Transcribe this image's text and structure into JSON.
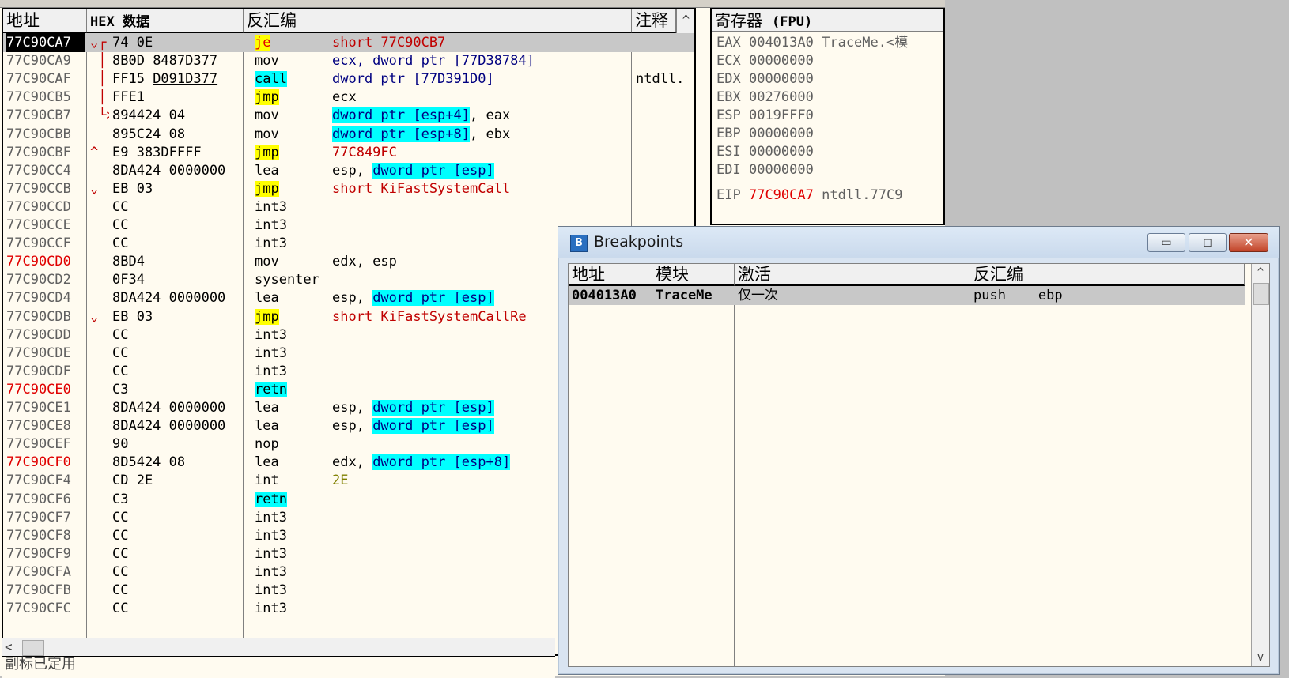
{
  "disasm": {
    "headers": [
      "地址",
      "HEX 数据",
      "反汇编",
      "注释"
    ],
    "rows": [
      {
        "addr": "77C90CA7",
        "mark": "⌄┌",
        "hex": "74 0E",
        "mn": "je",
        "mnstyle": "y",
        "op": "short 77C90CB7",
        "opstyle": "red",
        "cm": "",
        "sel": true,
        "addrred": false
      },
      {
        "addr": "77C90CA9",
        "mark": " │",
        "hex": "8B0D 8487D377",
        "mn": "mov",
        "mnstyle": "",
        "op": "ecx, dword ptr [77D38784]",
        "opstyle": "blue",
        "cm": "",
        "sel": false,
        "addrred": false
      },
      {
        "addr": "77C90CAF",
        "mark": " │",
        "hex": "FF15 D091D377",
        "mn": "call",
        "mnstyle": "c",
        "op": "dword ptr [77D391D0]",
        "opstyle": "blue",
        "cm": "ntdll.",
        "sel": false,
        "addrred": false
      },
      {
        "addr": "77C90CB5",
        "mark": " │",
        "hex": "FFE1",
        "mn": "jmp",
        "mnstyle": "y",
        "op": "ecx",
        "opstyle": "",
        "cm": "",
        "sel": false,
        "addrred": false
      },
      {
        "addr": "77C90CB7",
        "mark": " └>",
        "hex": "894424 04",
        "mn": "mov",
        "mnstyle": "",
        "op": "dword ptr [esp+4], eax",
        "opstyle": "hlfirst",
        "cm": "",
        "sel": false,
        "addrred": false
      },
      {
        "addr": "77C90CBB",
        "mark": "",
        "hex": "895C24 08",
        "mn": "mov",
        "mnstyle": "",
        "op": "dword ptr [esp+8], ebx",
        "opstyle": "hlfirst",
        "cm": "",
        "sel": false,
        "addrred": false
      },
      {
        "addr": "77C90CBF",
        "mark": "^",
        "hex": "E9 383DFFFF",
        "mn": "jmp",
        "mnstyle": "y",
        "op": "77C849FC",
        "opstyle": "red",
        "cm": "",
        "sel": false,
        "addrred": false
      },
      {
        "addr": "77C90CC4",
        "mark": "",
        "hex": "8DA424 0000000",
        "mn": "lea",
        "mnstyle": "",
        "op": "esp, dword ptr [esp]",
        "opstyle": "hllast",
        "cm": "",
        "sel": false,
        "addrred": false
      },
      {
        "addr": "77C90CCB",
        "mark": "⌄",
        "hex": "EB 03",
        "mn": "jmp",
        "mnstyle": "y",
        "op": "short KiFastSystemCall",
        "opstyle": "red",
        "cm": "",
        "sel": false,
        "addrred": false
      },
      {
        "addr": "77C90CCD",
        "mark": "",
        "hex": "CC",
        "mn": "int3",
        "mnstyle": "",
        "op": "",
        "opstyle": "",
        "cm": "",
        "sel": false,
        "addrred": false
      },
      {
        "addr": "77C90CCE",
        "mark": "",
        "hex": "CC",
        "mn": "int3",
        "mnstyle": "",
        "op": "",
        "opstyle": "",
        "cm": "",
        "sel": false,
        "addrred": false
      },
      {
        "addr": "77C90CCF",
        "mark": "",
        "hex": "CC",
        "mn": "int3",
        "mnstyle": "",
        "op": "",
        "opstyle": "",
        "cm": "",
        "sel": false,
        "addrred": false
      },
      {
        "addr": "77C90CD0",
        "mark": "",
        "hex": "8BD4",
        "mn": "mov",
        "mnstyle": "",
        "op": "edx, esp",
        "opstyle": "",
        "cm": "",
        "sel": false,
        "addrred": true
      },
      {
        "addr": "77C90CD2",
        "mark": "",
        "hex": "0F34",
        "mn": "sysenter",
        "mnstyle": "",
        "op": "",
        "opstyle": "",
        "cm": "",
        "sel": false,
        "addrred": false
      },
      {
        "addr": "77C90CD4",
        "mark": "",
        "hex": "8DA424 0000000",
        "mn": "lea",
        "mnstyle": "",
        "op": "esp, dword ptr [esp]",
        "opstyle": "hllast",
        "cm": "",
        "sel": false,
        "addrred": false
      },
      {
        "addr": "77C90CDB",
        "mark": "⌄",
        "hex": "EB 03",
        "mn": "jmp",
        "mnstyle": "y",
        "op": "short KiFastSystemCallRe",
        "opstyle": "red",
        "cm": "",
        "sel": false,
        "addrred": false
      },
      {
        "addr": "77C90CDD",
        "mark": "",
        "hex": "CC",
        "mn": "int3",
        "mnstyle": "",
        "op": "",
        "opstyle": "",
        "cm": "",
        "sel": false,
        "addrred": false
      },
      {
        "addr": "77C90CDE",
        "mark": "",
        "hex": "CC",
        "mn": "int3",
        "mnstyle": "",
        "op": "",
        "opstyle": "",
        "cm": "",
        "sel": false,
        "addrred": false
      },
      {
        "addr": "77C90CDF",
        "mark": "",
        "hex": "CC",
        "mn": "int3",
        "mnstyle": "",
        "op": "",
        "opstyle": "",
        "cm": "",
        "sel": false,
        "addrred": false
      },
      {
        "addr": "77C90CE0",
        "mark": "",
        "hex": "C3",
        "mn": "retn",
        "mnstyle": "c",
        "op": "",
        "opstyle": "",
        "cm": "",
        "sel": false,
        "addrred": true
      },
      {
        "addr": "77C90CE1",
        "mark": "",
        "hex": "8DA424 0000000",
        "mn": "lea",
        "mnstyle": "",
        "op": "esp, dword ptr [esp]",
        "opstyle": "hllast",
        "cm": "",
        "sel": false,
        "addrred": false
      },
      {
        "addr": "77C90CE8",
        "mark": "",
        "hex": "8DA424 0000000",
        "mn": "lea",
        "mnstyle": "",
        "op": "esp, dword ptr [esp]",
        "opstyle": "hllast",
        "cm": "",
        "sel": false,
        "addrred": false
      },
      {
        "addr": "77C90CEF",
        "mark": "",
        "hex": "90",
        "mn": "nop",
        "mnstyle": "",
        "op": "",
        "opstyle": "",
        "cm": "",
        "sel": false,
        "addrred": false
      },
      {
        "addr": "77C90CF0",
        "mark": "",
        "hex": "8D5424 08",
        "mn": "lea",
        "mnstyle": "",
        "op": "edx, dword ptr [esp+8]",
        "opstyle": "hllast",
        "cm": "",
        "sel": false,
        "addrred": true
      },
      {
        "addr": "77C90CF4",
        "mark": "",
        "hex": "CD 2E",
        "mn": "int",
        "mnstyle": "",
        "op": "2E",
        "opstyle": "olive",
        "cm": "",
        "sel": false,
        "addrred": false
      },
      {
        "addr": "77C90CF6",
        "mark": "",
        "hex": "C3",
        "mn": "retn",
        "mnstyle": "c",
        "op": "",
        "opstyle": "",
        "cm": "",
        "sel": false,
        "addrred": false
      },
      {
        "addr": "77C90CF7",
        "mark": "",
        "hex": "CC",
        "mn": "int3",
        "mnstyle": "",
        "op": "",
        "opstyle": "",
        "cm": "",
        "sel": false,
        "addrred": false
      },
      {
        "addr": "77C90CF8",
        "mark": "",
        "hex": "CC",
        "mn": "int3",
        "mnstyle": "",
        "op": "",
        "opstyle": "",
        "cm": "",
        "sel": false,
        "addrred": false
      },
      {
        "addr": "77C90CF9",
        "mark": "",
        "hex": "CC",
        "mn": "int3",
        "mnstyle": "",
        "op": "",
        "opstyle": "",
        "cm": "",
        "sel": false,
        "addrred": false
      },
      {
        "addr": "77C90CFA",
        "mark": "",
        "hex": "CC",
        "mn": "int3",
        "mnstyle": "",
        "op": "",
        "opstyle": "",
        "cm": "",
        "sel": false,
        "addrred": false
      },
      {
        "addr": "77C90CFB",
        "mark": "",
        "hex": "CC",
        "mn": "int3",
        "mnstyle": "",
        "op": "",
        "opstyle": "",
        "cm": "",
        "sel": false,
        "addrred": false
      },
      {
        "addr": "77C90CFC",
        "mark": "",
        "hex": "CC",
        "mn": "int3",
        "mnstyle": "",
        "op": "",
        "opstyle": "",
        "cm": "",
        "sel": false,
        "addrred": false
      }
    ],
    "bottom_label": "副标已定用"
  },
  "registers": {
    "title": "寄存器",
    "title_suffix": "(FPU)",
    "rows": [
      {
        "name": "EAX",
        "value": "004013A0",
        "comment": "TraceMe.<模",
        "red": false
      },
      {
        "name": "ECX",
        "value": "00000000",
        "comment": "",
        "red": false
      },
      {
        "name": "EDX",
        "value": "00000000",
        "comment": "",
        "red": false
      },
      {
        "name": "EBX",
        "value": "00276000",
        "comment": "",
        "red": false
      },
      {
        "name": "ESP",
        "value": "0019FFF0",
        "comment": "",
        "red": false
      },
      {
        "name": "EBP",
        "value": "00000000",
        "comment": "",
        "red": false
      },
      {
        "name": "ESI",
        "value": "00000000",
        "comment": "",
        "red": false
      },
      {
        "name": "EDI",
        "value": "00000000",
        "comment": "",
        "red": false
      }
    ],
    "eip": {
      "name": "EIP",
      "value": "77C90CA7",
      "comment": "ntdll.77C9"
    }
  },
  "breakpoints": {
    "title": "Breakpoints",
    "icon_letter": "B",
    "headers": [
      "地址",
      "模块",
      "激活",
      "反汇编"
    ],
    "rows": [
      {
        "addr": "004013A0",
        "module": "TraceMe",
        "active": "仅一次",
        "disasm": "push    ebp"
      }
    ],
    "buttons": {
      "min": "▭",
      "max": "◻",
      "close": "✕"
    }
  }
}
